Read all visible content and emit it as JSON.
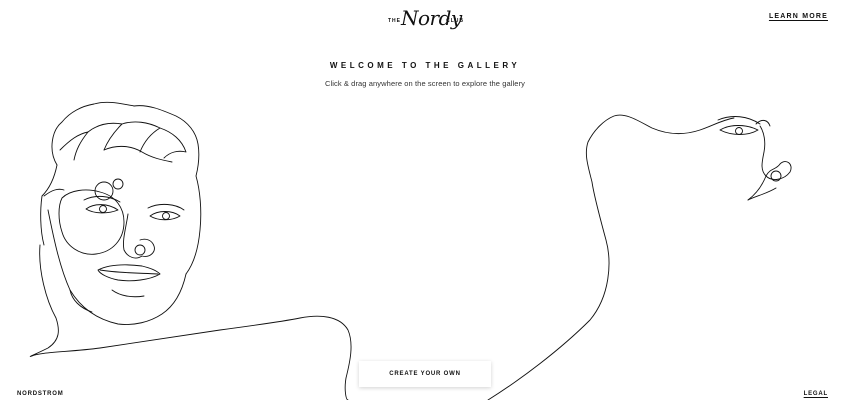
{
  "header": {
    "logo": {
      "prefix": "THE",
      "script": "Nordy",
      "suffix": "CLUB"
    },
    "learn_more": "LEARN MORE"
  },
  "main": {
    "title": "WELCOME TO THE GALLERY",
    "subtitle": "Click & drag anywhere on the screen to explore the gallery",
    "create_button": "CREATE YOUR OWN"
  },
  "footer": {
    "brand": "NORDSTROM",
    "legal": "LEGAL"
  }
}
